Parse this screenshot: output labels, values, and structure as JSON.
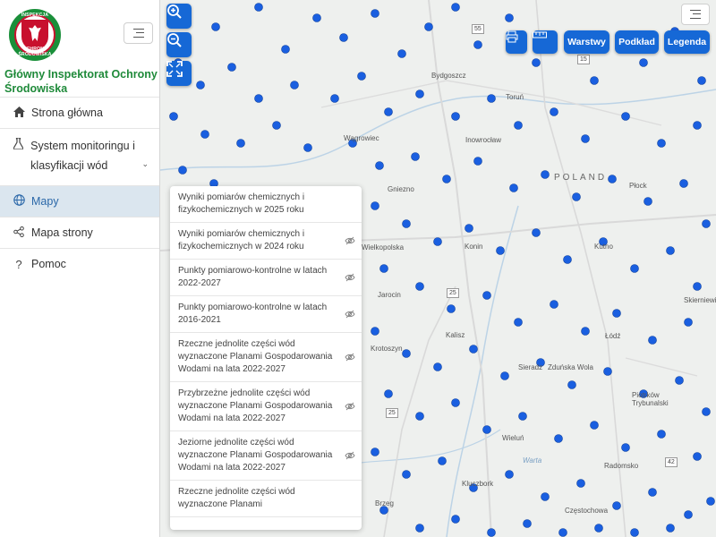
{
  "org": {
    "logo_text_top": "INSPEKCJA",
    "logo_text_bottom": "OCHRONY ŚRODOWISKA",
    "name": "Główny Inspektorat Ochrony Środowiska"
  },
  "nav": {
    "items": [
      {
        "label": "Strona główna",
        "icon": "home-icon"
      },
      {
        "label": "System monitoringu i klasyfikacji wód",
        "icon": "flask-icon"
      },
      {
        "label": "Mapy",
        "icon": "globe-icon"
      },
      {
        "label": "Mapa strony",
        "icon": "share-icon"
      },
      {
        "label": "Pomoc",
        "icon": "question-icon"
      }
    ]
  },
  "map": {
    "buttons": {
      "warstwy": "Warstwy",
      "podklad": "Podkład",
      "legenda": "Legenda"
    },
    "labels": {
      "bydgoszcz": "Bydgoszcz",
      "torun": "Toruń",
      "inowroclaw": "Inowrocław",
      "wagrowiec": "Wągrowiec",
      "poland": "POLAND",
      "plock": "Płock",
      "gniezno": "Gniezno",
      "kutno": "Kutno",
      "konin": "Konin",
      "wielkopolska": "Wielkopolska",
      "jarocin": "Jarocin",
      "kalisz": "Kalisz",
      "lodz": "Łódź",
      "skierniewice": "Skierniewice",
      "krotoszyn": "Krotoszyn",
      "sieradz": "Sieradz",
      "zdunska": "Zduńska Wola",
      "piotrkow": "Piotrków Trybunalski",
      "wielun": "Wieluń",
      "radomsko": "Radomsko",
      "kluczbork": "Kluczbork",
      "czestochowa": "Częstochowa",
      "warta": "Warta",
      "brzeg": "Brzeg"
    },
    "roads": {
      "r55": "55",
      "r15": "15",
      "r25a": "25",
      "r25b": "25",
      "r42": "42"
    }
  },
  "layers": {
    "items": [
      {
        "label": "Wyniki pomiarów chemicznych i fizykochemicznych w 2025 roku",
        "visible": true
      },
      {
        "label": "Wyniki pomiarów chemicznych i fizykochemicznych w 2024 roku",
        "visible": false
      },
      {
        "label": "Punkty pomiarowo-kontrolne w latach 2022-2027",
        "visible": false
      },
      {
        "label": "Punkty pomiarowo-kontrolne w latach 2016-2021",
        "visible": false
      },
      {
        "label": "Rzeczne jednolite części wód wyznaczone Planami Gospodarowania Wodami na lata 2022-2027",
        "visible": false
      },
      {
        "label": "Przybrzeżne jednolite części wód wyznaczone Planami Gospodarowania Wodami na lata 2022-2027",
        "visible": false
      },
      {
        "label": "Jeziorne jednolite części wód wyznaczone Planami Gospodarowania Wodami na lata 2022-2027",
        "visible": false
      },
      {
        "label": "Rzeczne jednolite części wód wyznaczone Planami",
        "visible": false
      }
    ]
  },
  "colors": {
    "accent": "#1668d6",
    "brand_green": "#1f8a3a",
    "point": "#1a5fe0"
  }
}
